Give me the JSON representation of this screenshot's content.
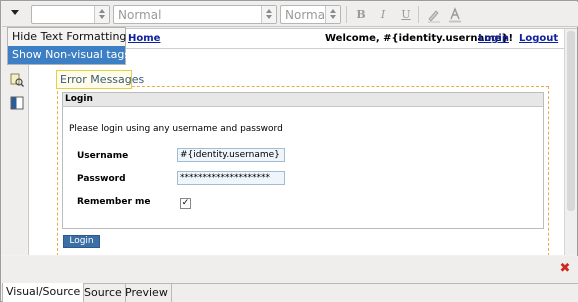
{
  "toolbar": {
    "font_family_value": "",
    "paragraph_style_value": "Normal",
    "font_size_value": "Normal",
    "bold_label": "B",
    "italic_label": "I",
    "underline_label": "U"
  },
  "menu": {
    "items": [
      {
        "label": "Hide Text Formatting",
        "selected": false
      },
      {
        "label": "Show Non-visual tags",
        "selected": true
      }
    ]
  },
  "canvas": {
    "top_links": {
      "home": "Home",
      "welcome": "Welcome, #{identity.username}!",
      "login": "Login",
      "logout": "Logout"
    },
    "error_messages_label": "Error Messages",
    "panel": {
      "header": "Login",
      "intro": "Please login using any username and password",
      "username_label": "Username",
      "username_value": "#{identity.username}",
      "password_label": "Password",
      "password_value": "********************",
      "remember_label": "Remember me",
      "remember_checked": true
    },
    "login_button": "Login"
  },
  "tabs": [
    {
      "label": "Visual/Source",
      "active": true
    },
    {
      "label": "Source",
      "active": false
    },
    {
      "label": "Preview",
      "active": false
    }
  ],
  "colors": {
    "menu_highlight": "#3c7fc4",
    "link": "#10219f",
    "dashed_border": "#f0a94a",
    "login_button": "#3d6fa7",
    "close_icon": "#cc2a1a"
  }
}
